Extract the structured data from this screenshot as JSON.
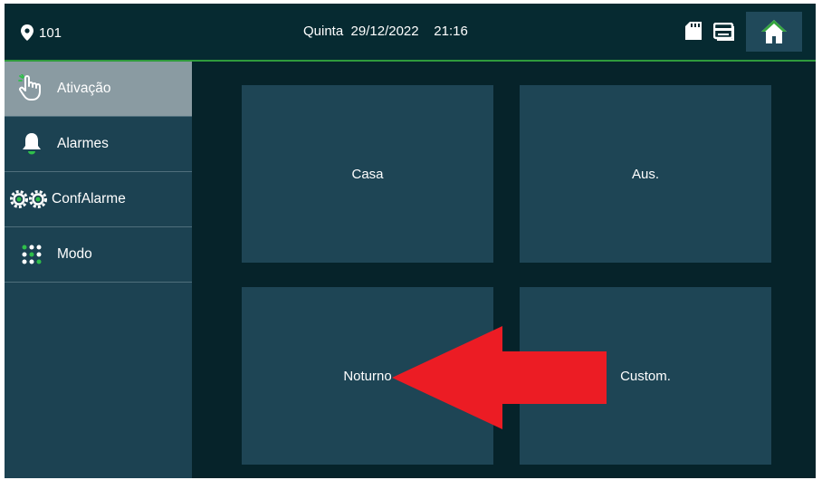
{
  "status_bar": {
    "room": "101",
    "weekday": "Quinta",
    "date": "29/12/2022",
    "time": "21:16"
  },
  "sidebar": {
    "items": [
      {
        "label": "Ativação",
        "icon": "hand-pointer-icon",
        "active": true
      },
      {
        "label": "Alarmes",
        "icon": "bell-icon",
        "active": false
      },
      {
        "label": "ConfAlarme",
        "icon": "gears-icon",
        "active": false
      },
      {
        "label": "Modo",
        "icon": "dots-grid-icon",
        "active": false
      }
    ]
  },
  "modes": [
    {
      "label": "Casa"
    },
    {
      "label": "Aus."
    },
    {
      "label": "Noturno"
    },
    {
      "label": "Custom."
    }
  ],
  "annotation": {
    "arrow": "red-arrow-icon",
    "color": "#ec1c24"
  },
  "colors": {
    "background": "#06232a",
    "sidebar": "#1c4252",
    "sidebar_active": "#8a9ba2",
    "tile": "#1e4555",
    "accent_green": "#2f9b3c"
  }
}
